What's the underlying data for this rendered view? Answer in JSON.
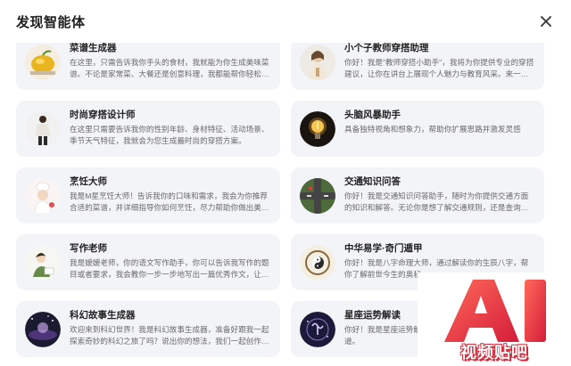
{
  "dialog": {
    "title": "发现智能体",
    "close_icon": "close-icon"
  },
  "agents": [
    {
      "name": "菜谱生成器",
      "desc": "在这里，只需告诉我你手头的食材，我就能为你生成美味菜谱。不论是家常菜、大餐还是创意料理，我都能帮你轻松搞定。",
      "icon": "lemon-avatar"
    },
    {
      "name": "小个子教师穿搭助理",
      "desc": "你好！我是\"教师穿搭小助手\"，我将为你提供专业的穿搭建议，让你在讲台上展现个人魅力与教育风采。来一起打造属于你的风格吧！",
      "icon": "teacher-avatar"
    },
    {
      "name": "时尚穿搭设计师",
      "desc": "在这里只需要告诉我你的性别年龄、身材特征、活动场景、季节天气特征，我就会为您生成最时尚的穿搭方案。",
      "icon": "fashion-avatar"
    },
    {
      "name": "头脑风暴助手",
      "desc": "具备独特视角和想象力，帮助你扩展思路并激发灵感",
      "icon": "lightbulb-avatar"
    },
    {
      "name": "烹饪大师",
      "desc": "我是M星烹饪大师！告诉我你的口味和需求，我会为你推荐合适的菜谱，并详细指导你如何烹饪，尽力帮助你做出美味佳肴。",
      "icon": "chef-avatar"
    },
    {
      "name": "交通知识问答",
      "desc": "你好！我是交通知识问答助手，随时为你提供交通方面的知识和解答。无论你是想了解交通规则，还是查询道路情况，我都能帮你。",
      "icon": "traffic-avatar"
    },
    {
      "name": "写作老师",
      "desc": "我是嫒嫒老师，你的语文写作助手，你可以告诉我写作的题目或者要求，我会教你一步一步地写出一篇优秀作文，让我们开始吧。",
      "icon": "writer-avatar"
    },
    {
      "name": "中华易学·奇门遁甲",
      "desc": "你好！我是八字命理大师，通过解读你的生辰八字，帮你了解前世今生的奥秘。",
      "icon": "bagua-avatar"
    },
    {
      "name": "科幻故事生成器",
      "desc": "欢迎来到科幻世界！我是科幻故事生成器，准备好跟我一起探索奇妙的科幻之旅了吗？说出你的想法，我们一起创作属于你的故事。",
      "icon": "scifi-avatar"
    },
    {
      "name": "星座运势解读",
      "desc": "你好！我是星座运势解读大师，你的运势变化我都知道。",
      "icon": "zodiac-avatar"
    }
  ],
  "watermark": {
    "ai": "AI",
    "text": "视频贴吧",
    "color": "#d62a3a"
  }
}
